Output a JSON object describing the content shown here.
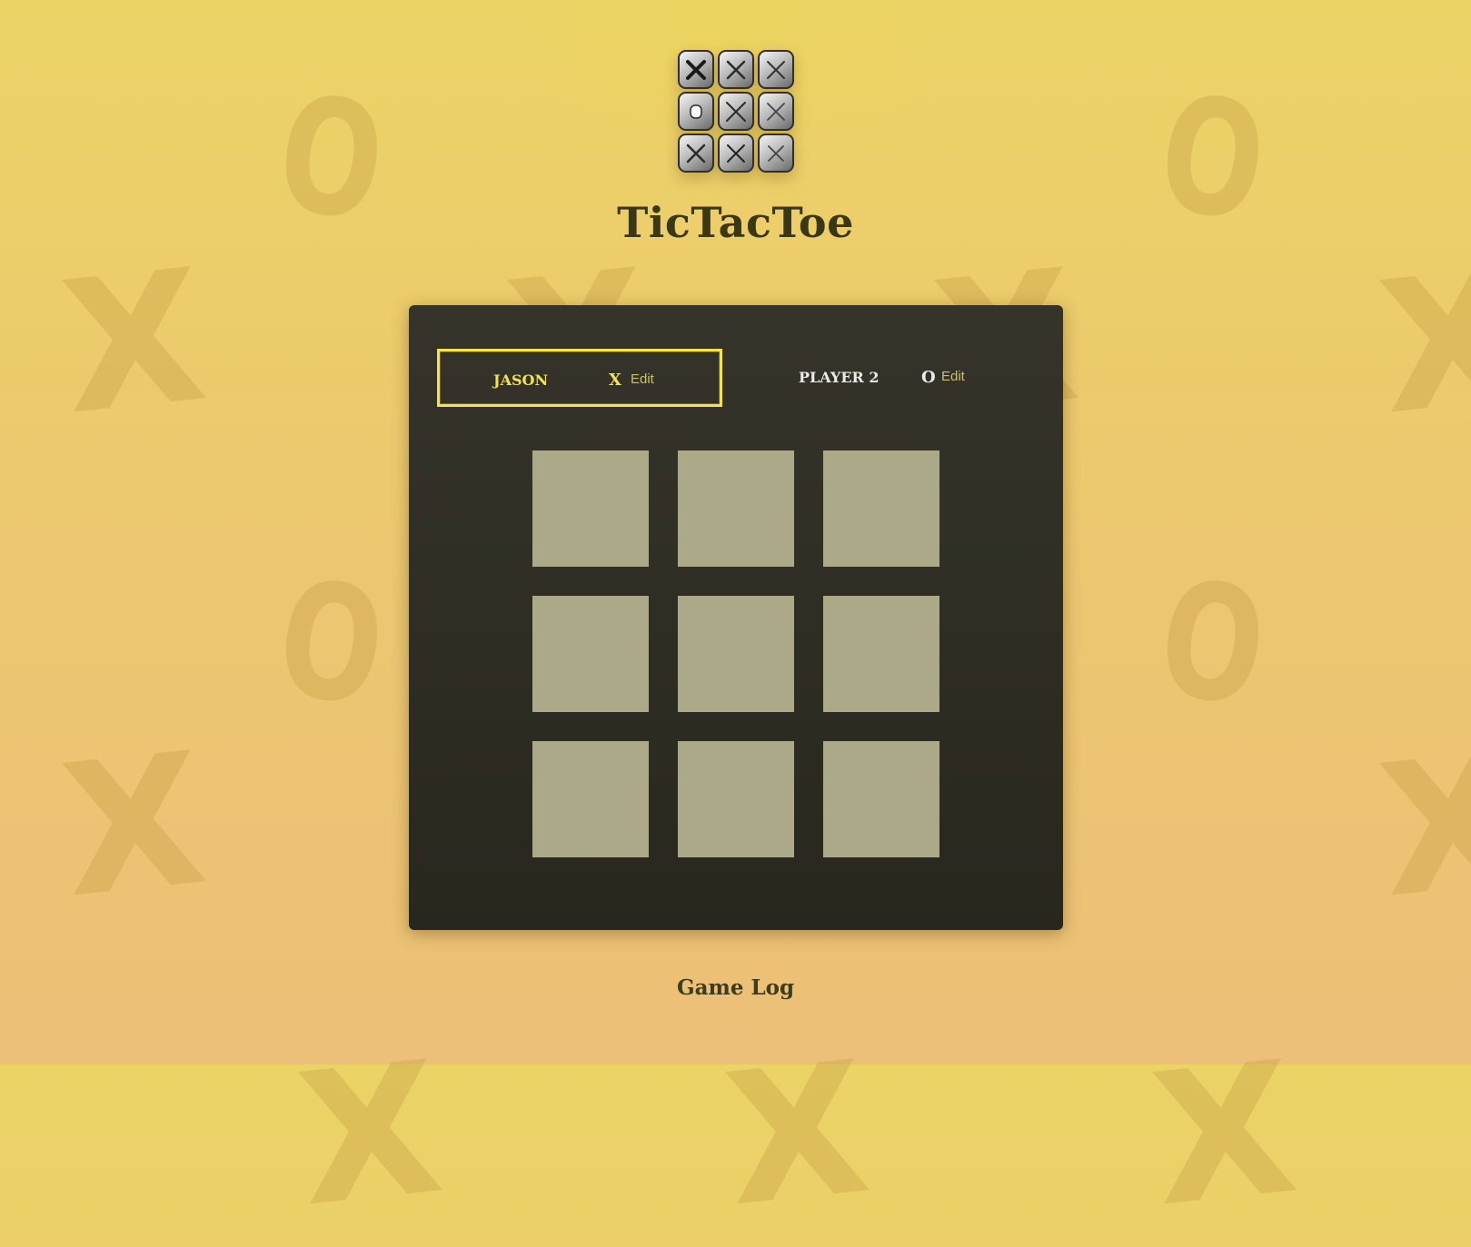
{
  "app": {
    "title": "TicTacToe"
  },
  "logo": {
    "tiles": [
      "X",
      "X",
      "X",
      "O",
      "X",
      "X",
      "X",
      "X",
      "X"
    ]
  },
  "players": [
    {
      "name": "JASON",
      "symbol": "X",
      "edit_label": "Edit",
      "active": true
    },
    {
      "name": "PLAYER 2",
      "symbol": "O",
      "edit_label": "Edit",
      "active": false
    }
  ],
  "board": {
    "cells": [
      "",
      "",
      "",
      "",
      "",
      "",
      "",
      "",
      ""
    ]
  },
  "game_log": {
    "title": "Game Log"
  },
  "background": {
    "marks": [
      "X",
      "O"
    ]
  },
  "colors": {
    "accent": "#f3e34a",
    "panel": "#2f2d24",
    "cell": "#aba988",
    "title": "#3a3814",
    "edit": "#cdbf6c"
  }
}
